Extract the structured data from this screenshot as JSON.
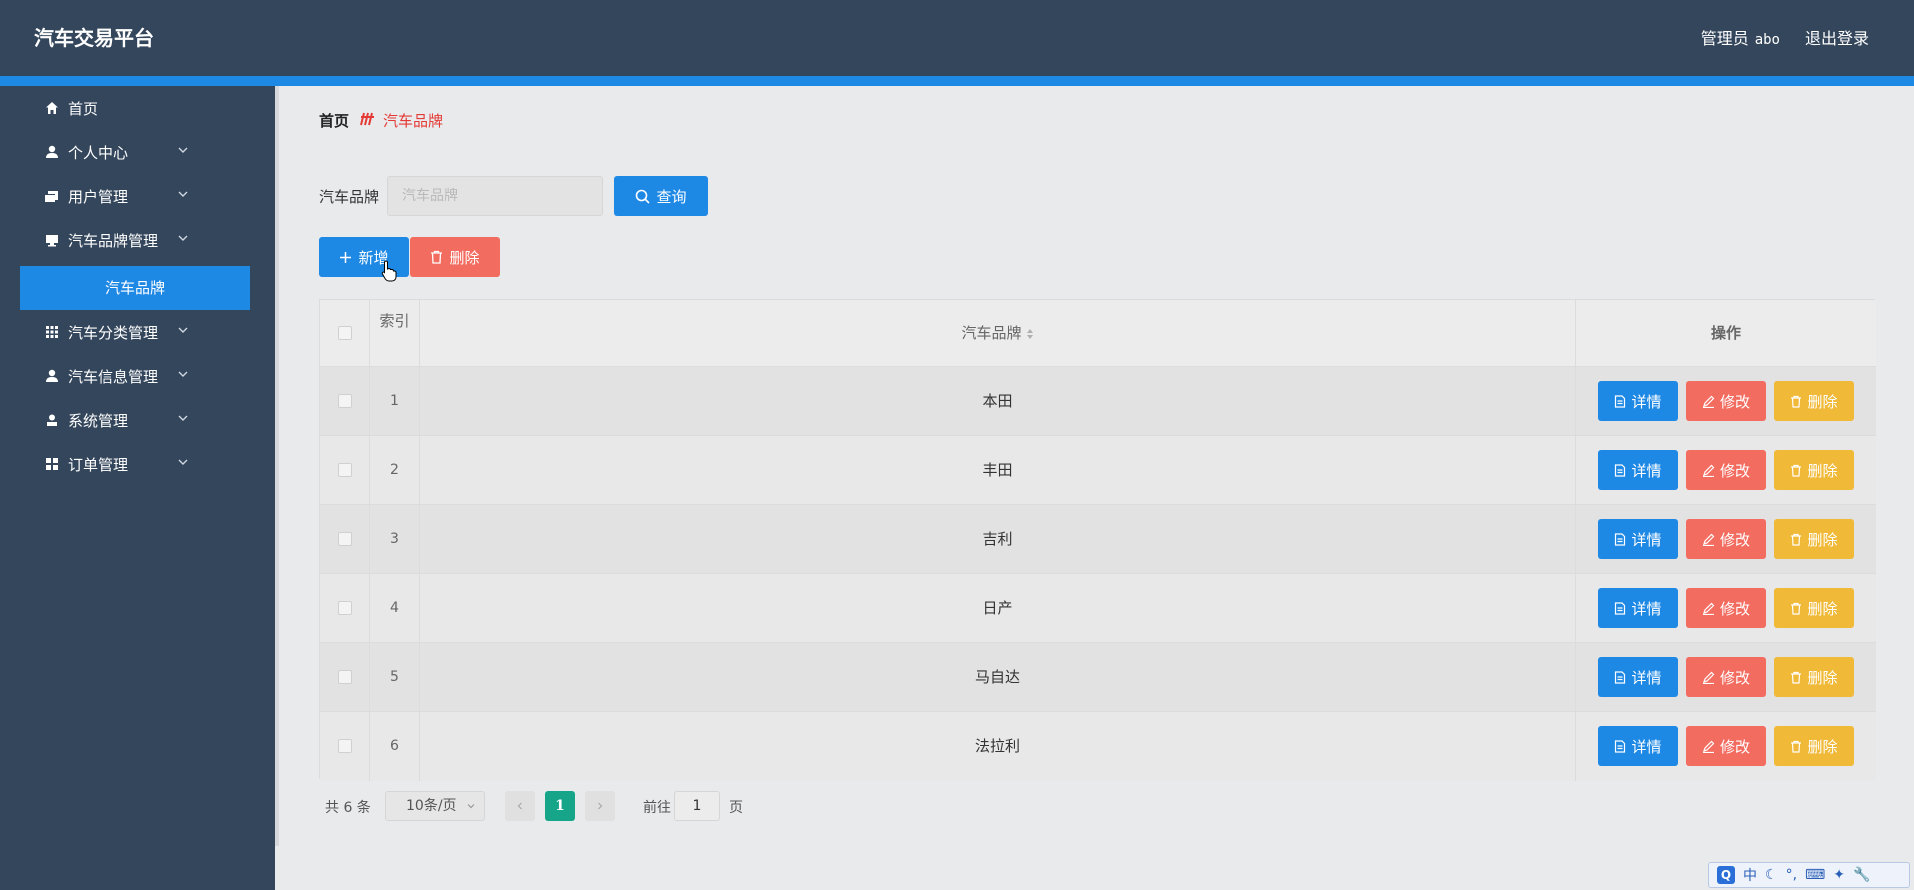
{
  "header": {
    "brand": "汽车交易平台",
    "role": "管理员",
    "username": "abo",
    "logout": "退出登录"
  },
  "sidebar": {
    "items": [
      {
        "label": "首页",
        "icon": "home-icon"
      },
      {
        "label": "个人中心",
        "icon": "person-icon"
      },
      {
        "label": "用户管理",
        "icon": "users-icon"
      },
      {
        "label": "汽车品牌管理",
        "icon": "monitor-icon"
      },
      {
        "label": "汽车分类管理",
        "icon": "grid-icon"
      },
      {
        "label": "汽车信息管理",
        "icon": "person-icon"
      },
      {
        "label": "系统管理",
        "icon": "user-icon"
      },
      {
        "label": "订单管理",
        "icon": "dashboard-icon"
      }
    ],
    "active_sub": "汽车品牌"
  },
  "breadcrumb": {
    "home": "首页",
    "current": "汽车品牌"
  },
  "search": {
    "label": "汽车品牌",
    "placeholder": "汽车品牌",
    "button": "查询"
  },
  "actions": {
    "add": "新增",
    "delete": "删除"
  },
  "table": {
    "headers": {
      "index": "索引",
      "brand": "汽车品牌",
      "ops": "操作"
    },
    "rows": [
      {
        "index": "1",
        "brand": "本田"
      },
      {
        "index": "2",
        "brand": "丰田"
      },
      {
        "index": "3",
        "brand": "吉利"
      },
      {
        "index": "4",
        "brand": "日产"
      },
      {
        "index": "5",
        "brand": "马自达"
      },
      {
        "index": "6",
        "brand": "法拉利"
      }
    ],
    "op_labels": {
      "detail": "详情",
      "edit": "修改",
      "delete": "删除"
    }
  },
  "pagination": {
    "total": "共 6 条",
    "page_size": "10条/页",
    "current_page": "1",
    "goto": "前往",
    "goto_value": "1",
    "page_suffix": "页"
  },
  "ime": {
    "lang": "中"
  },
  "colors": {
    "topbar": "#34465c",
    "accent": "#1e88e5",
    "danger": "#f36c60",
    "warning": "#f0b938",
    "pager_active": "#17a589"
  }
}
